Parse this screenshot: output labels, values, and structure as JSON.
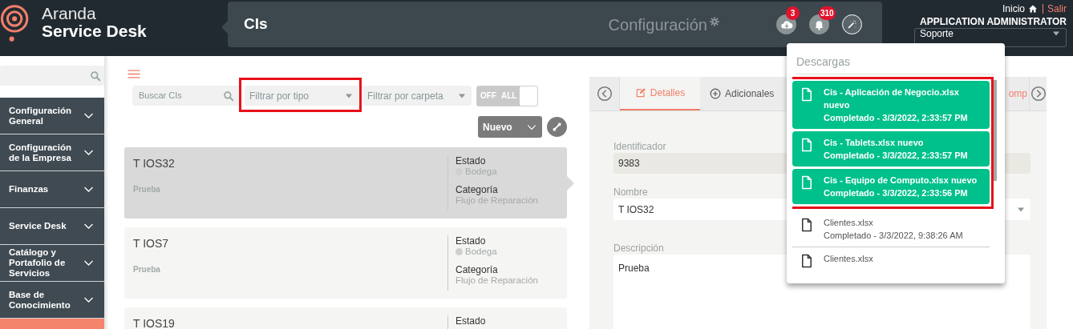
{
  "header": {
    "logo": {
      "line1": "Aranda",
      "line2": "Service Desk"
    },
    "title": "CIs",
    "section": "Configuración",
    "downloads_badge": "3",
    "notifications_badge": "310",
    "home_link": "Inicio",
    "logout_link": "Salir",
    "user": "APPLICATION ADMINISTRATOR",
    "role_select": {
      "value": "Soporte"
    }
  },
  "sidebar": {
    "items": [
      {
        "label": "Configuración General",
        "selected": false
      },
      {
        "label": "Configuración de la Empresa",
        "selected": false
      },
      {
        "label": "Finanzas",
        "selected": false
      },
      {
        "label": "Service Desk",
        "selected": false
      },
      {
        "label": "Catálogo y Portafolio de Servicios",
        "selected": false
      },
      {
        "label": "Base de Conocimiento",
        "selected": false
      },
      {
        "selected": true
      }
    ]
  },
  "list": {
    "search": {
      "placeholder": "Buscar CIs"
    },
    "type_filter": {
      "placeholder": "Filtrar por tipo",
      "highlighted": true
    },
    "folder_filter": {
      "placeholder": "Filtrar por carpeta",
      "highlighted": false
    },
    "toggle": {
      "off_label": "OFF",
      "all_label": "ALL",
      "on": false
    },
    "new_button": "Nuevo",
    "cards": [
      {
        "title": "T IOS32",
        "description": "Prueba",
        "selected": true,
        "fields": [
          {
            "label": "Estado",
            "value": "Bodega",
            "kind": "status"
          },
          {
            "label": "Categoría",
            "value": "Flujo de Reparación",
            "kind": "text"
          }
        ]
      },
      {
        "title": "T IOS7",
        "description": "Prueba",
        "selected": false,
        "fields": [
          {
            "label": "Estado",
            "value": "Bodega",
            "kind": "status"
          },
          {
            "label": "Categoría",
            "value": "Flujo de Reparación",
            "kind": "text"
          }
        ]
      },
      {
        "title": "T IOS19",
        "selected": false,
        "fields": [
          {
            "label": "Estado"
          }
        ]
      }
    ]
  },
  "detail": {
    "tabs": [
      {
        "label": "Detalles",
        "kind": "edit",
        "selected": true
      },
      {
        "label": "Adicionales",
        "kind": "add",
        "selected": false
      },
      {
        "label": "omp",
        "kind": "plain",
        "selected": false
      }
    ],
    "fields": [
      {
        "label": "Identificador",
        "value": "9383",
        "kind": "readonly"
      },
      {
        "label": "Nombre",
        "value": "T IOS32",
        "kind": "select"
      },
      {
        "label": "Descripción",
        "value": "Prueba",
        "kind": "textarea"
      }
    ]
  },
  "downloads": {
    "title": "Descargas",
    "items": [
      {
        "name": "Cis - Aplicación de Negocio.xlsx nuevo",
        "status": "Completado - 3/3/2022, 2:33:57 PM",
        "new": true,
        "highlighted": true
      },
      {
        "name": "Cis - Tablets.xlsx nuevo",
        "status": "Completado - 3/3/2022, 2:33:57 PM",
        "new": true,
        "highlighted": true
      },
      {
        "name": "Cis - Equipo de Computo.xlsx nuevo",
        "status": "Completado - 3/3/2022, 2:33:56 PM",
        "new": true,
        "highlighted": true
      },
      {
        "name": "Clientes.xlsx",
        "status": "Completado - 3/3/2022, 9:38:26 AM",
        "new": false,
        "highlighted": false
      },
      {
        "name": "Clientes.xlsx",
        "new": false,
        "highlighted": false
      }
    ]
  }
}
